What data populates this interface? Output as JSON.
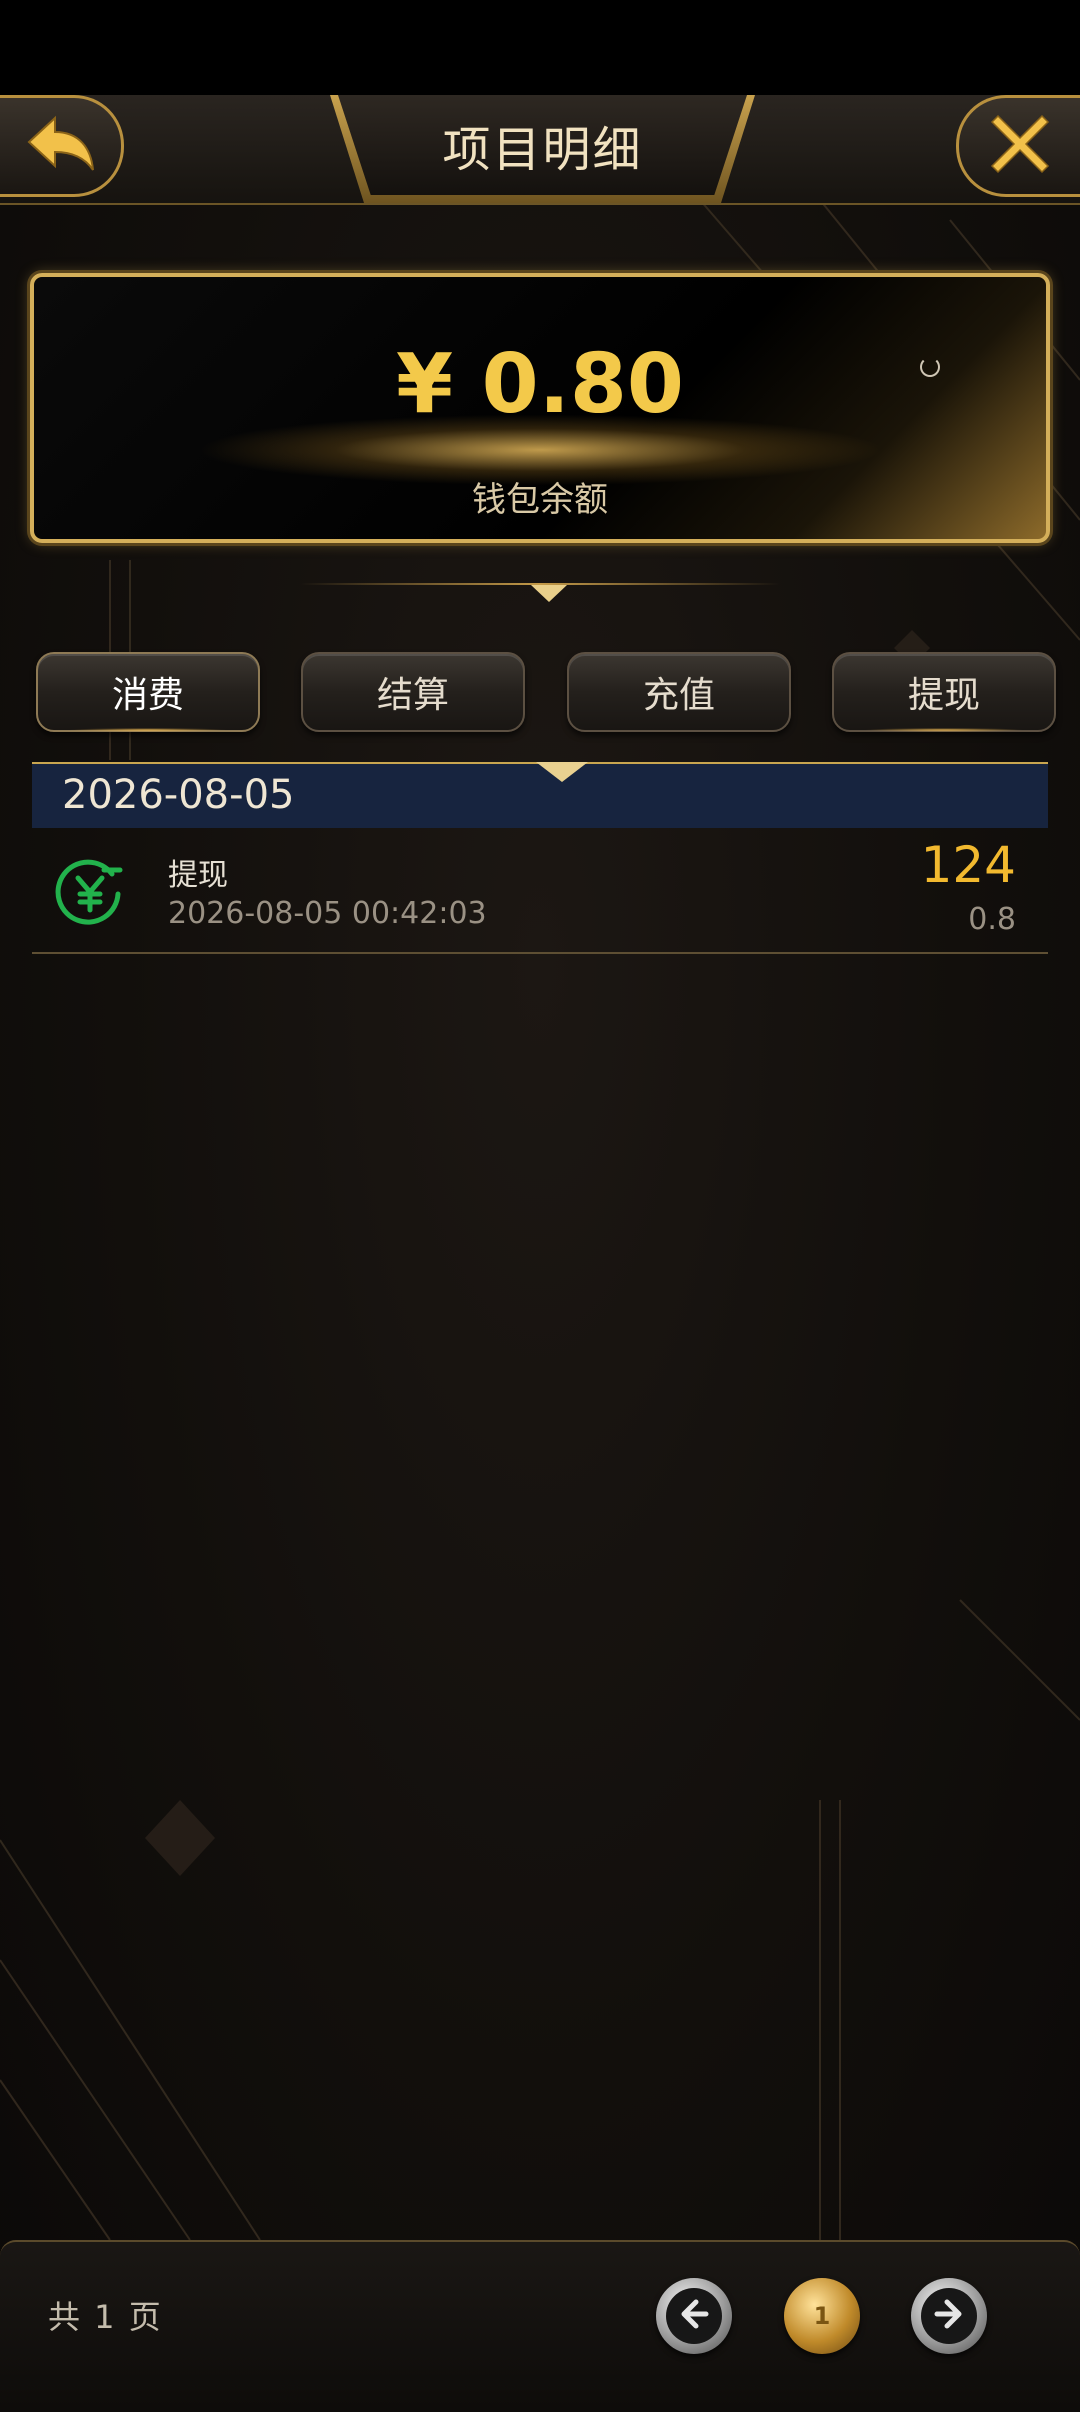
{
  "header": {
    "title": "项目明细",
    "back_icon": "back-arrow-icon",
    "close_icon": "close-icon"
  },
  "balance": {
    "amount": "¥ 0.80",
    "label": "钱包余额"
  },
  "tabs": [
    {
      "label": "消费",
      "active": true
    },
    {
      "label": "结算",
      "active": false
    },
    {
      "label": "充值",
      "active": false
    },
    {
      "label": "提现",
      "active": false
    }
  ],
  "records_group": {
    "date": "2026-08-05",
    "items": [
      {
        "icon": "yuan-withdraw-icon",
        "type": "提现",
        "time": "2026-08-05 00:42:03",
        "amount": "124",
        "balance": "0.8"
      }
    ]
  },
  "pagination": {
    "summary": "共 1 页",
    "current_page": "1"
  },
  "colors": {
    "gold": "#f3c94a",
    "amount": "#f2b92f",
    "date_bar": "#17243f",
    "icon_green": "#22b24c"
  }
}
